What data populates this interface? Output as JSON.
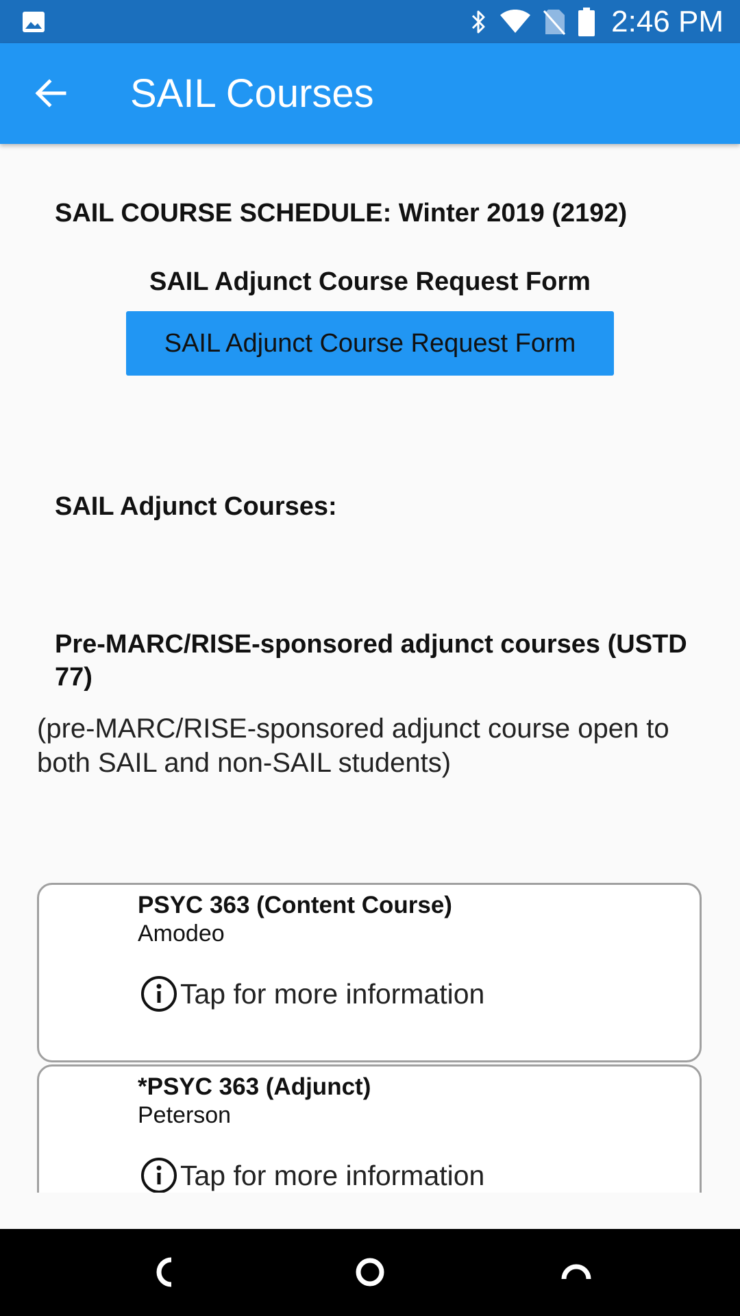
{
  "status_bar": {
    "time": "2:46 PM",
    "icons": [
      "gallery-icon",
      "bluetooth-icon",
      "wifi-icon",
      "no-sim-icon",
      "battery-icon"
    ]
  },
  "app_bar": {
    "title": "SAIL Courses",
    "back_icon": "arrow-back-icon",
    "color": "#2196f3"
  },
  "content": {
    "schedule_title": "SAIL COURSE SCHEDULE: Winter 2019 (2192)",
    "form_label": "SAIL Adjunct Course Request Form",
    "form_button_label": "SAIL Adjunct Course Request Form",
    "adjunct_heading": "SAIL Adjunct Courses:",
    "pre_marc_heading": "Pre-MARC/RISE-sponsored adjunct courses  (USTD 77)",
    "pre_marc_description": "(pre-MARC/RISE-sponsored adjunct course open to both SAIL and non-SAIL students)",
    "courses": [
      {
        "name": "PSYC 363 (Content Course)",
        "instructor": "Amodeo",
        "info_label": "Tap for more information"
      },
      {
        "name": "*PSYC 363 (Adjunct)",
        "instructor": "Peterson",
        "info_label": "Tap for more information"
      }
    ]
  },
  "nav_bar": {
    "buttons": [
      "back-nav-icon",
      "home-nav-icon",
      "recents-nav-icon"
    ]
  }
}
